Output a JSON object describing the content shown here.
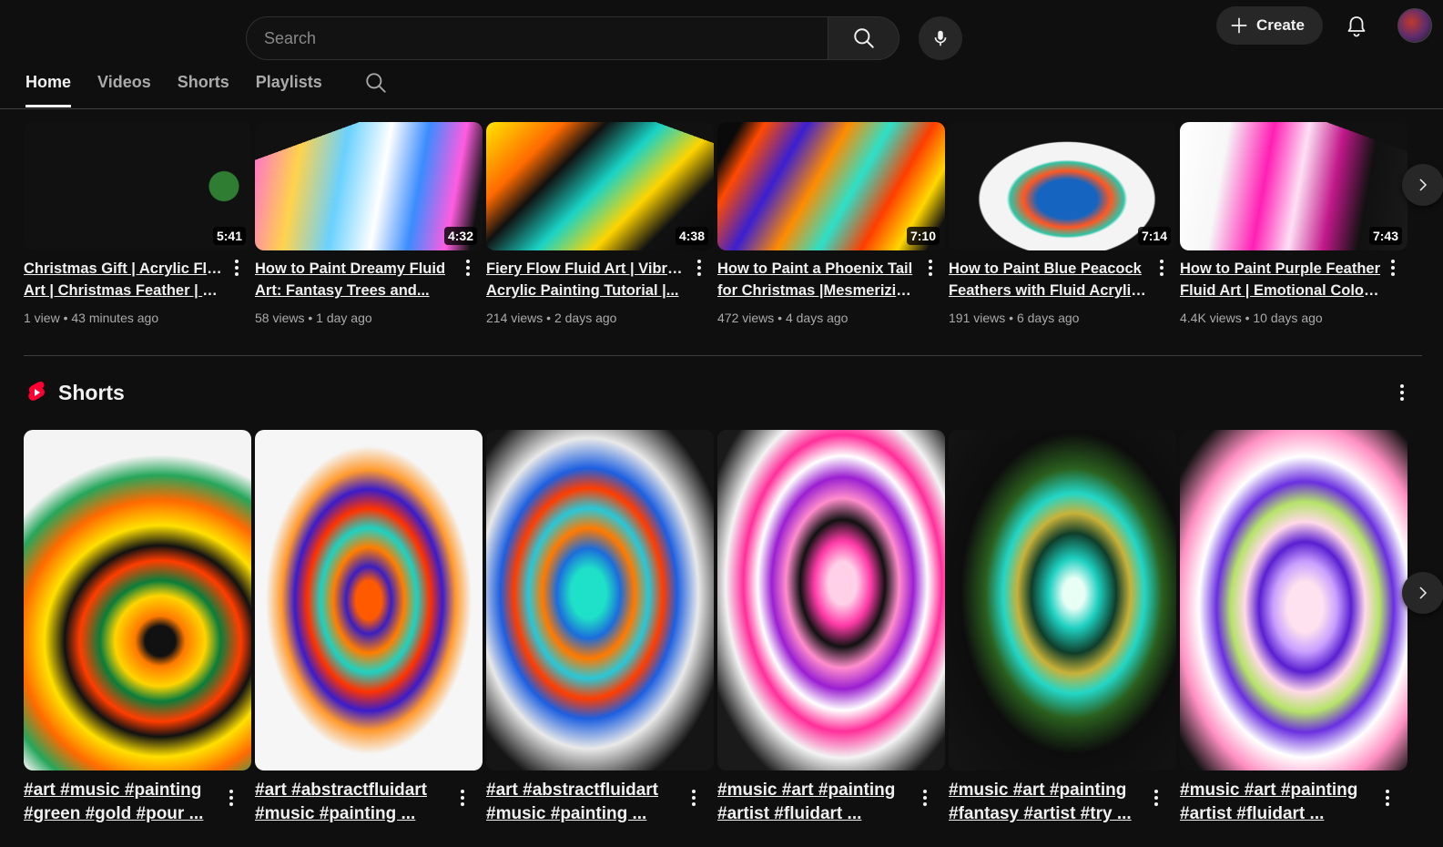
{
  "header": {
    "search_placeholder": "Search",
    "search_icon": "search-icon",
    "mic_icon": "mic-icon",
    "create_label": "Create",
    "bell_icon": "bell-icon",
    "avatar": "avatar"
  },
  "tabs": [
    {
      "label": "Home",
      "active": true
    },
    {
      "label": "Videos",
      "active": false
    },
    {
      "label": "Shorts",
      "active": false
    },
    {
      "label": "Playlists",
      "active": false
    }
  ],
  "videos": [
    {
      "line1": "Christmas Gift | Acrylic Fluid",
      "line2": "Art | Christmas Feather | Sil...",
      "views": "1 view",
      "age": "43 minutes ago",
      "duration": "5:41"
    },
    {
      "line1": "How to Paint Dreamy Fluid",
      "line2": "Art: Fantasy Trees and...",
      "views": "58 views",
      "age": "1 day ago",
      "duration": "4:32"
    },
    {
      "line1": "Fiery Flow Fluid Art | Vibrant",
      "line2": "Acrylic Painting Tutorial |...",
      "views": "214 views",
      "age": "2 days ago",
      "duration": "4:38"
    },
    {
      "line1": "How to Paint a Phoenix Tail",
      "line2": "for Christmas |Mesmerizing...",
      "views": "472 views",
      "age": "4 days ago",
      "duration": "7:10"
    },
    {
      "line1": "How to Paint Blue Peacock",
      "line2": "Feathers with Fluid Acrylic...",
      "views": "191 views",
      "age": "6 days ago",
      "duration": "7:14"
    },
    {
      "line1": "How to Paint Purple Feather",
      "line2": "Fluid Art | Emotional Colors...",
      "views": "4.4K views",
      "age": "10 days ago",
      "duration": "7:43"
    }
  ],
  "shorts_section": {
    "title": "Shorts",
    "items": [
      {
        "line1": "#art #music #painting",
        "line2": "#green #gold #pour ..."
      },
      {
        "line1": "#art #abstractfluidart",
        "line2": "#music #painting ..."
      },
      {
        "line1": "#art #abstractfluidart",
        "line2": "#music #painting ..."
      },
      {
        "line1": "#music #art #painting",
        "line2": "#artist #fluidart ..."
      },
      {
        "line1": "#music #art #painting",
        "line2": "#fantasy #artist #try ..."
      },
      {
        "line1": "#music #art #painting",
        "line2": "#artist #fluidart ..."
      }
    ]
  },
  "colors": {
    "background": "#0f0f0f",
    "text_primary": "#f1f1f1",
    "text_secondary": "#aaaaaa",
    "shorts_red": "#ff0033"
  }
}
